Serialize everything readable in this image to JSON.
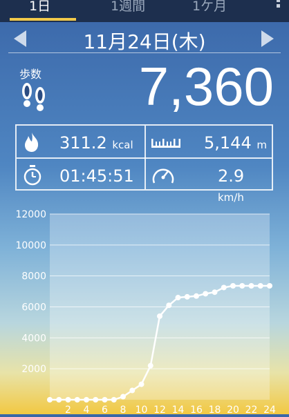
{
  "tabs": [
    {
      "label": "1日",
      "active": true
    },
    {
      "label": "1週間",
      "active": false
    },
    {
      "label": "1ケ月",
      "active": false
    }
  ],
  "date": "11月24日(木)",
  "steps": {
    "label": "歩数",
    "value": "7,360"
  },
  "stats": {
    "calories": {
      "value": "311.2",
      "unit": "kcal"
    },
    "distance": {
      "value": "5,144",
      "unit": "m"
    },
    "duration": {
      "value": "01:45:51"
    },
    "speed": {
      "value": "2.9",
      "unit": "km/h"
    }
  },
  "icons": {
    "steps": "footprints-icon",
    "calories": "flame-icon",
    "distance": "ruler-icon",
    "duration": "stopwatch-icon",
    "speed": "speedometer-icon"
  },
  "colors": {
    "topbar": "#1d2f4e",
    "accent": "#f1c94a",
    "text": "#ffffff"
  },
  "chart_data": {
    "type": "line",
    "ylim": [
      0,
      12000
    ],
    "yticks": [
      2000,
      4000,
      6000,
      8000,
      10000,
      12000
    ],
    "xlim": [
      0,
      24
    ],
    "xticks": [
      2,
      4,
      6,
      8,
      10,
      12,
      14,
      16,
      18,
      20,
      22,
      24
    ],
    "x": [
      0,
      1,
      2,
      3,
      4,
      5,
      6,
      7,
      8,
      9,
      10,
      11,
      12,
      13,
      14,
      15,
      16,
      17,
      18,
      19,
      20,
      21,
      22,
      23,
      24
    ],
    "values": [
      0,
      0,
      0,
      0,
      0,
      0,
      0,
      0,
      200,
      600,
      1000,
      2200,
      5400,
      6100,
      6600,
      6650,
      6700,
      6850,
      6950,
      7250,
      7360,
      7360,
      7360,
      7360,
      7360
    ],
    "grid": true
  }
}
